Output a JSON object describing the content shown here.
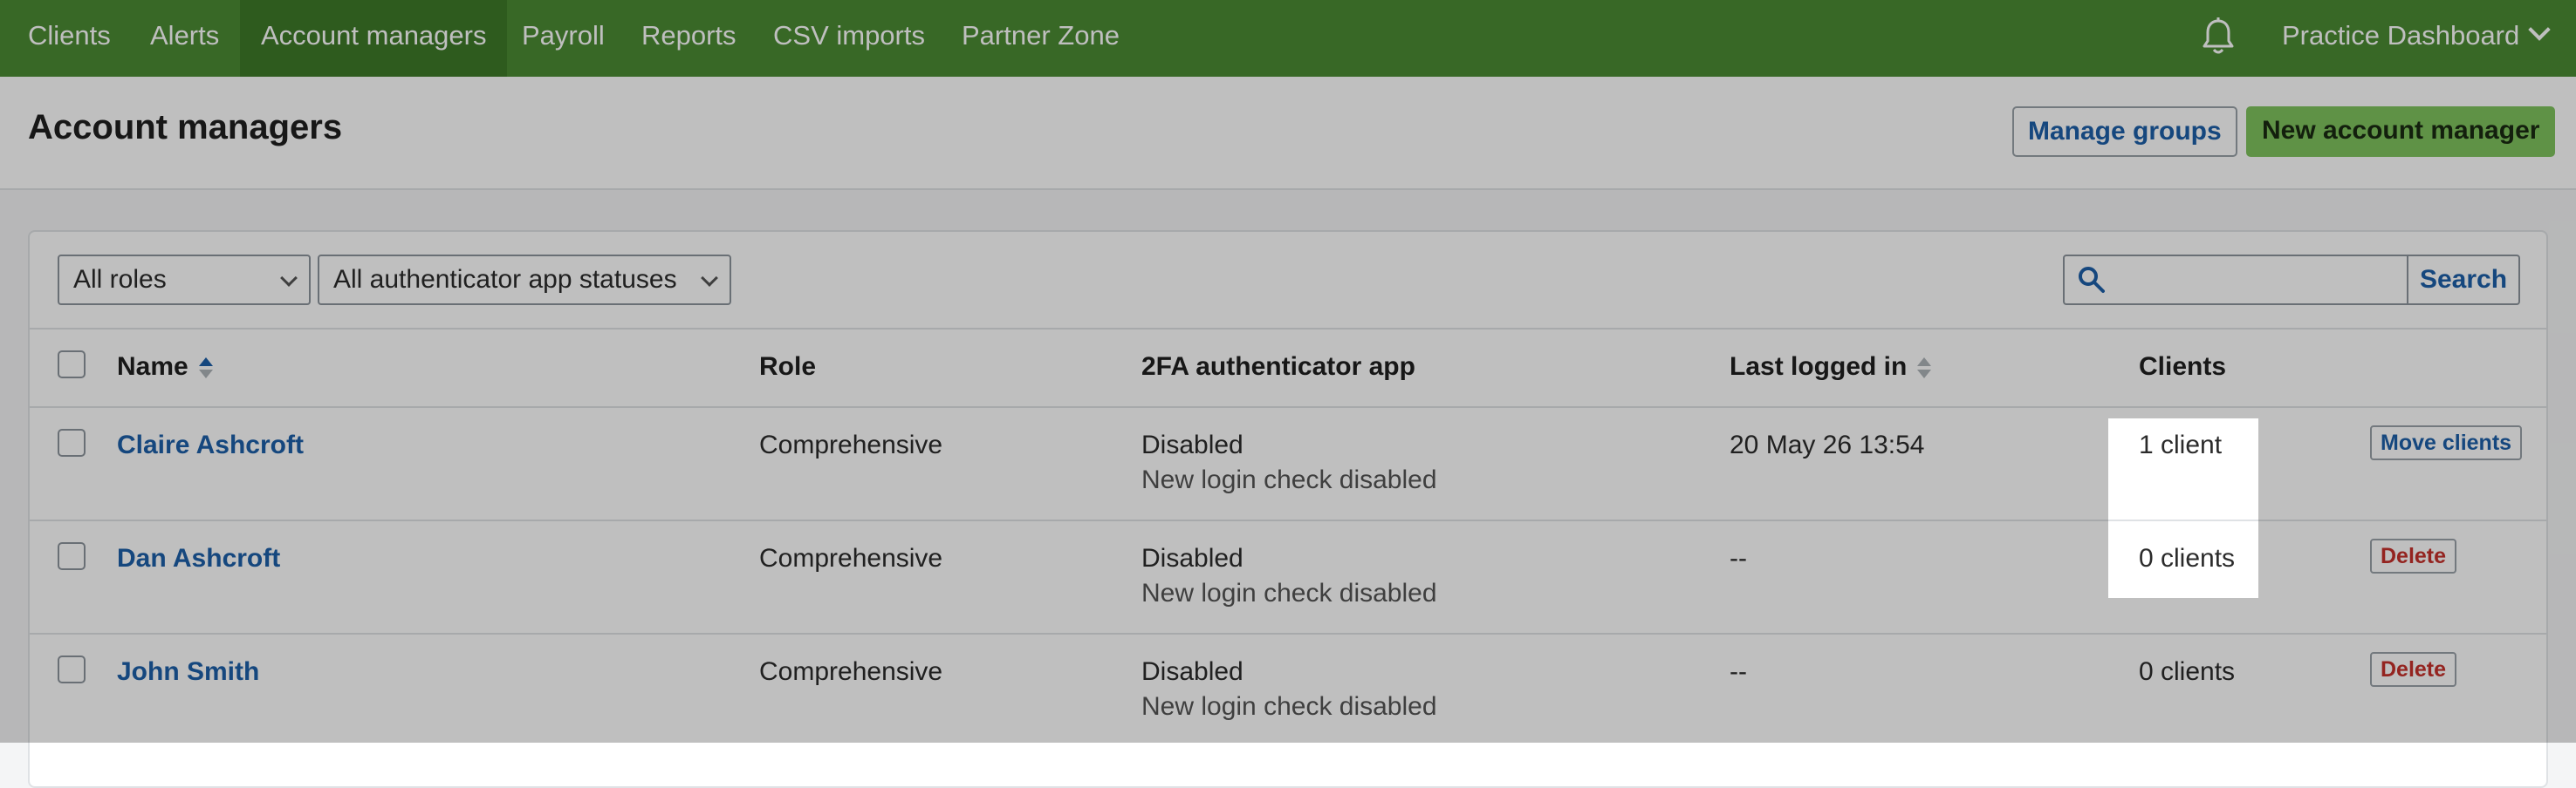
{
  "nav": {
    "items": [
      {
        "label": "Clients"
      },
      {
        "label": "Alerts"
      },
      {
        "label": "Account managers"
      },
      {
        "label": "Payroll"
      },
      {
        "label": "Reports"
      },
      {
        "label": "CSV imports"
      },
      {
        "label": "Partner Zone"
      }
    ],
    "active_index": 2,
    "practice_label": "Practice Dashboard"
  },
  "header": {
    "title": "Account managers",
    "manage_groups_label": "Manage groups",
    "new_manager_label": "New account manager"
  },
  "filters": {
    "role_selected": "All roles",
    "app_status_selected": "All authenticator app statuses",
    "search_value": "",
    "search_button_label": "Search"
  },
  "table": {
    "columns": {
      "name": "Name",
      "role": "Role",
      "twofa": "2FA authenticator app",
      "last_logged_in": "Last logged in",
      "clients": "Clients"
    },
    "rows": [
      {
        "name": "Claire Ashcroft",
        "role": "Comprehensive",
        "twofa_status": "Disabled",
        "twofa_note": "New login check disabled",
        "last_logged_in": "20 May 26 13:54",
        "clients": "1 client",
        "action": "Move clients"
      },
      {
        "name": "Dan Ashcroft",
        "role": "Comprehensive",
        "twofa_status": "Disabled",
        "twofa_note": "New login check disabled",
        "last_logged_in": "--",
        "clients": "0 clients",
        "action": "Delete"
      },
      {
        "name": "John Smith",
        "role": "Comprehensive",
        "twofa_status": "Disabled",
        "twofa_note": "New login check disabled",
        "last_logged_in": "--",
        "clients": "0 clients",
        "action": "Delete"
      }
    ]
  },
  "colors": {
    "nav_green": "#4b8b33",
    "link_blue": "#1d5fa8",
    "delete_red": "#c6302b",
    "primary_button": "#7fc35e"
  }
}
